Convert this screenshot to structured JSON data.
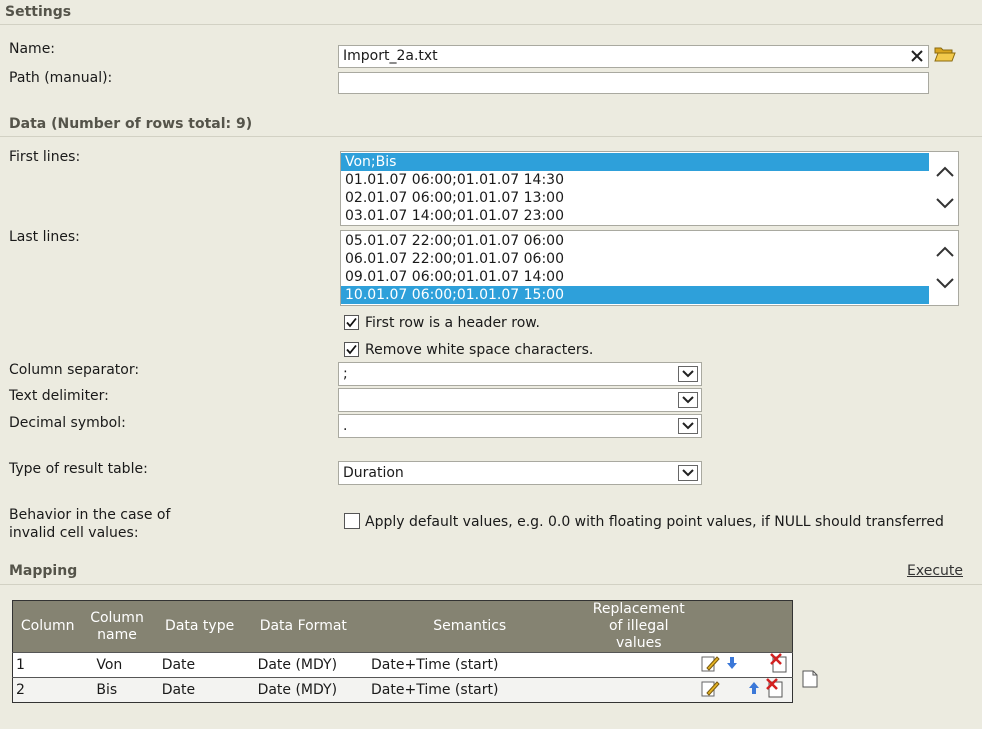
{
  "settings": {
    "title": "Settings",
    "name_label": "Name:",
    "name_value": "Import_2a.txt",
    "path_label": "Path (manual):",
    "path_value": ""
  },
  "data": {
    "title": "Data (Number of rows total: 9)",
    "first_lines_label": "First lines:",
    "first_lines": [
      "Von;Bis",
      "01.01.07 06:00;01.01.07 14:30",
      "02.01.07 06:00;01.01.07 13:00",
      "03.01.07 14:00;01.01.07 23:00"
    ],
    "first_lines_selected": 0,
    "last_lines_label": "Last lines:",
    "last_lines": [
      "05.01.07 22:00;01.01.07 06:00",
      "06.01.07 22:00;01.01.07 06:00",
      "09.01.07 06:00;01.01.07 14:00",
      "10.01.07 06:00;01.01.07 15:00"
    ],
    "last_lines_selected": 3,
    "header_row_label": "First row is a header row.",
    "header_row_checked": true,
    "whitespace_label": "Remove white space characters.",
    "whitespace_checked": true,
    "column_separator_label": "Column separator:",
    "column_separator_value": ";",
    "text_delimiter_label": "Text delimiter:",
    "text_delimiter_value": "",
    "decimal_symbol_label": "Decimal symbol:",
    "decimal_symbol_value": ".",
    "result_type_label": "Type of result table:",
    "result_type_value": "Duration",
    "invalid_behavior_label_1": "Behavior in the case of",
    "invalid_behavior_label_2": "invalid cell values:",
    "default_values_label": "Apply default values, e.g. 0.0 with floating point values, if NULL should transferred",
    "default_values_checked": false
  },
  "mapping": {
    "title": "Mapping",
    "execute_label": "Execute",
    "headers": [
      "Column",
      "Column name",
      "Data type",
      "Data Format",
      "Semantics",
      "Replacement of illegal values"
    ],
    "rows": [
      {
        "column": "1",
        "name": "Von",
        "type": "Date",
        "format": "Date (MDY)",
        "semantics": "Date+Time (start)"
      },
      {
        "column": "2",
        "name": "Bis",
        "type": "Date",
        "format": "Date (MDY)",
        "semantics": "Date+Time (start)"
      }
    ]
  },
  "colors": {
    "selection": "#2ea0da",
    "table_header": "#858372",
    "background": "#ecebe0"
  },
  "icons": [
    "clear-icon",
    "folder-open-icon",
    "chevron-up-icon",
    "chevron-down-icon",
    "edit-icon",
    "arrow-down-icon",
    "arrow-up-icon",
    "delete-icon",
    "new-document-icon"
  ]
}
